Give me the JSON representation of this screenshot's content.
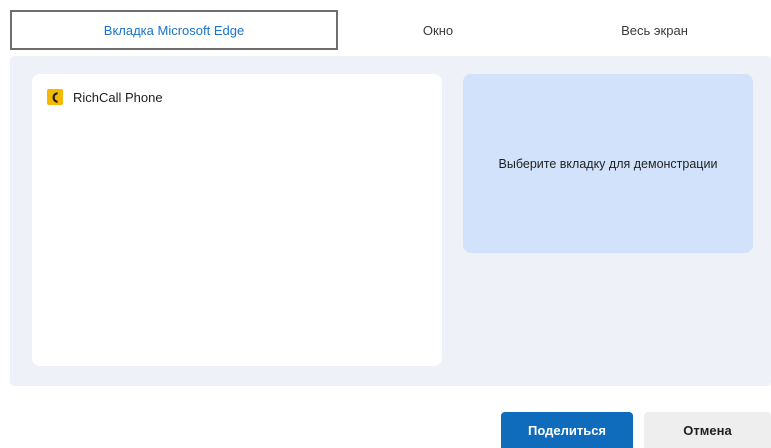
{
  "tabs": {
    "edge_tab": "Вкладка Microsoft Edge",
    "window_tab": "Окно",
    "screen_tab": "Весь экран"
  },
  "list": {
    "items": [
      {
        "label": "RichCall Phone",
        "icon": "richcall-phone-icon",
        "icon_color": "#f3b800"
      }
    ]
  },
  "preview": {
    "message": "Выберите вкладку для демонстрации"
  },
  "footer": {
    "share_label": "Поделиться",
    "cancel_label": "Отмена"
  },
  "colors": {
    "accent": "#0f6cbd",
    "active_tab_text": "#1a73c8",
    "panel_bg": "#eef2f8",
    "preview_bg": "#d2e2fb"
  }
}
